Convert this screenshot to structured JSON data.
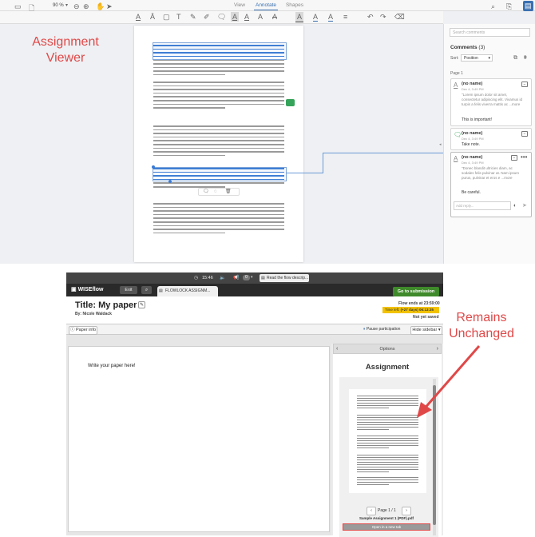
{
  "top_screenshot": {
    "toolbar": {
      "zoom": "90 %",
      "tabs": [
        {
          "label": "View",
          "active": false
        },
        {
          "label": "Annotate",
          "active": true
        },
        {
          "label": "Shapes",
          "active": false
        }
      ]
    },
    "search": {
      "placeholder": "Search comments"
    },
    "comments": {
      "title": "Comments",
      "count": "(3)",
      "sort_label": "Sort:",
      "sort_value": "Position",
      "page_label": "Page 1",
      "items": [
        {
          "author": "(no name)",
          "time": "Dec 4, 3:49 PM",
          "quote": "\"Lorem ipsum dolor sit amet, consectetur adipiscing elit. Vivamus id turpis a felis viverra mattis ac ...more",
          "note": "This is important!",
          "icon": "text-highlight-icon"
        },
        {
          "author": "(no name)",
          "time": "Dec 4, 3:49 PM",
          "quote": "",
          "note": "Take note.",
          "icon": "comment-icon"
        },
        {
          "author": "(no name)",
          "time": "Dec 4, 3:49 PM",
          "quote": "\"Donec blandit ultricies diam, ac sodales felis pulvinar at. Nam ipsum purus, pulvinar et eros e ...more",
          "note": "Be careful.",
          "icon": "text-highlight-icon"
        }
      ],
      "reply_placeholder": "Add reply..."
    },
    "callout": "Assignment Viewer"
  },
  "bottom_screenshot": {
    "brand": "WISEflow",
    "exit_label": "Exit",
    "timer": "15:46",
    "notif_count": "0",
    "flow_desc": "Read the flow descrip...",
    "tab_label": "FLOWLOCK ASSIGNM...",
    "submit_label": "Go to submission",
    "title": "Title: My paper",
    "byline": "By: Nicole Waldack",
    "flow_ends": "Flow ends at 23:59:00",
    "time_left_label": "Time left: ",
    "time_left_value": "(+27 days) 06:13:35",
    "not_saved": "Not yet saved",
    "paper_info": "Paper info",
    "pause": "Pause participation",
    "hide_sidebar": "Hide sidebar",
    "options": "Options",
    "assignment_heading": "Assignment",
    "editor_text": "Write your paper here!",
    "page_info": "Page 1 / 1",
    "file_name": "Sample Assignment 1 (PDF).pdf",
    "open_tab": "Open in a new tab",
    "callout": "Remains Unchanged"
  },
  "colors": {
    "callout_red": "#e04848",
    "accent_blue": "#3a6fb0",
    "submit_green": "#3f8a2a",
    "time_left_yellow": "#f2c200"
  }
}
